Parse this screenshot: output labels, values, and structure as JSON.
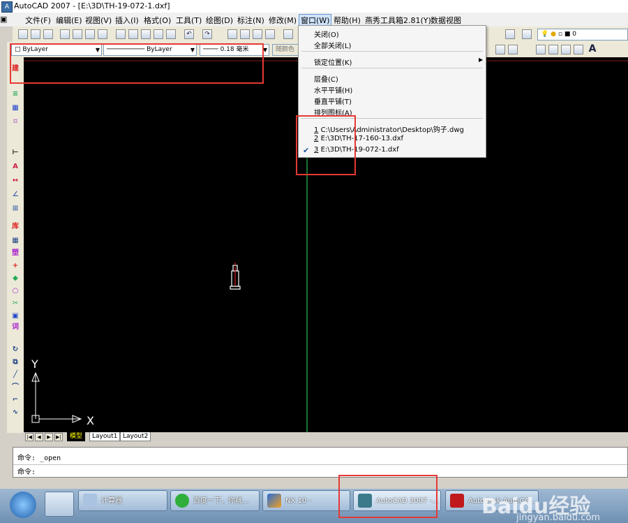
{
  "window": {
    "title": "AutoCAD 2007 - [E:\\3D\\TH-19-072-1.dxf]",
    "app_icon": "autocad-icon"
  },
  "menubar": {
    "items": [
      "文件(F)",
      "编辑(E)",
      "视图(V)",
      "插入(I)",
      "格式(O)",
      "工具(T)",
      "绘图(D)",
      "标注(N)",
      "修改(M)",
      "窗口(W)",
      "帮助(H)",
      "燕秀工具箱2.81(Y)",
      "数据视图"
    ]
  },
  "properties_toolbar": {
    "color": "ByLayer",
    "linetype": "ByLayer",
    "lineweight": "0.18 毫米",
    "plotstyle": "随颜色"
  },
  "layer_toolbar": {
    "current_layer": "0"
  },
  "window_menu": {
    "items": [
      "关闭(O)",
      "全部关闭(L)"
    ],
    "lock": "锁定位置(K)",
    "arrange": [
      "层叠(C)",
      "水平平铺(H)",
      "垂直平铺(T)",
      "排列图标(A)"
    ],
    "files": [
      {
        "index": "1",
        "path": "C:\\Users\\Administrator\\Desktop\\钩子.dwg",
        "checked": false
      },
      {
        "index": "2",
        "path": "E:\\3D\\TH-17-160-13.dxf",
        "checked": false
      },
      {
        "index": "3",
        "path": "E:\\3D\\TH-19-072-1.dxf",
        "checked": true
      }
    ]
  },
  "left_toolbar": {
    "labels": [
      "建",
      "库",
      "塑",
      "词"
    ]
  },
  "drawing": {
    "ucs_y": "Y",
    "ucs_x": "X",
    "background": "#000000",
    "axis_line_color": "#1f9a3a"
  },
  "layout_tabs": [
    "模型",
    "Layout1",
    "Layout2"
  ],
  "command": {
    "line1_prompt": "命令:",
    "line1_value": "_open",
    "line2_prompt": "命令:"
  },
  "taskbar": {
    "items": [
      "计算器",
      "百度一下，你就...",
      "NX 10 -",
      "AutoCAD 2007 -...",
      "Autodesk AutoCA..."
    ],
    "watermark": "Baidu经验",
    "watermark_url": "jingyan.baidu.com"
  },
  "annotations_color": "#e53935"
}
